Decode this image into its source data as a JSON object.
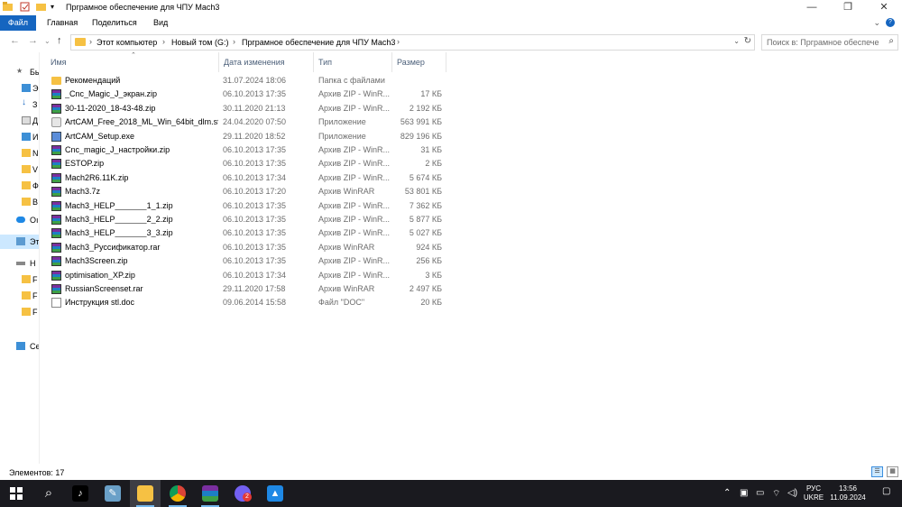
{
  "window": {
    "title": "Прграмное обеспечение для ЧПУ Mach3",
    "minimize": "—",
    "maximize": "❐",
    "close": "✕"
  },
  "ribbon": {
    "tabs": [
      "Файл",
      "Главная",
      "Поделиться",
      "Вид"
    ],
    "expand": "⌄",
    "help": "?"
  },
  "address": {
    "crumbs": [
      "Этот компьютер",
      "Новый том (G:)",
      "Прграмное обеспечение для ЧПУ Mach3"
    ],
    "search_placeholder": "Поиск в: Прграмное обеспече..."
  },
  "columns": {
    "name": "Имя",
    "date": "Дата изменения",
    "type": "Тип",
    "size": "Размер"
  },
  "nav_labels": [
    "Бь",
    "Э",
    "З",
    "Д",
    "И",
    "N",
    "V",
    "Ф",
    "В",
    "Oı",
    "Эт",
    "Н",
    "F",
    "F",
    "F",
    "Се"
  ],
  "files": [
    {
      "name": "Рекомендаций",
      "date": "31.07.2024 18:06",
      "type": "Папка с файлами",
      "size": "",
      "icon": "folder"
    },
    {
      "name": "_Cnc_Magic_J_экран.zip",
      "date": "06.10.2013 17:35",
      "type": "Архив ZIP - WinR...",
      "size": "17 КБ",
      "icon": "zip"
    },
    {
      "name": "30-11-2020_18-43-48.zip",
      "date": "30.11.2020 21:13",
      "type": "Архив ZIP - WinR...",
      "size": "2 192 КБ",
      "icon": "zip"
    },
    {
      "name": "ArtCAM_Free_2018_ML_Win_64bit_dlm.sf...",
      "date": "24.04.2020 07:50",
      "type": "Приложение",
      "size": "563 991 КБ",
      "icon": "app"
    },
    {
      "name": "ArtCAM_Setup.exe",
      "date": "29.11.2020 18:52",
      "type": "Приложение",
      "size": "829 196 КБ",
      "icon": "exe"
    },
    {
      "name": "Cnc_magic_J_настройки.zip",
      "date": "06.10.2013 17:35",
      "type": "Архив ZIP - WinR...",
      "size": "31 КБ",
      "icon": "zip"
    },
    {
      "name": "ESTOP.zip",
      "date": "06.10.2013 17:35",
      "type": "Архив ZIP - WinR...",
      "size": "2 КБ",
      "icon": "zip"
    },
    {
      "name": "Mach2R6.11K.zip",
      "date": "06.10.2013 17:34",
      "type": "Архив ZIP - WinR...",
      "size": "5 674 КБ",
      "icon": "zip"
    },
    {
      "name": "Mach3.7z",
      "date": "06.10.2013 17:20",
      "type": "Архив WinRAR",
      "size": "53 801 КБ",
      "icon": "zip"
    },
    {
      "name": "Mach3_HELP_______1_1.zip",
      "date": "06.10.2013 17:35",
      "type": "Архив ZIP - WinR...",
      "size": "7 362 КБ",
      "icon": "zip"
    },
    {
      "name": "Mach3_HELP_______2_2.zip",
      "date": "06.10.2013 17:35",
      "type": "Архив ZIP - WinR...",
      "size": "5 877 КБ",
      "icon": "zip"
    },
    {
      "name": "Mach3_HELP_______3_3.zip",
      "date": "06.10.2013 17:35",
      "type": "Архив ZIP - WinR...",
      "size": "5 027 КБ",
      "icon": "zip"
    },
    {
      "name": "Mach3_Руссификатор.rar",
      "date": "06.10.2013 17:35",
      "type": "Архив WinRAR",
      "size": "924 КБ",
      "icon": "zip"
    },
    {
      "name": "Mach3Screen.zip",
      "date": "06.10.2013 17:35",
      "type": "Архив ZIP - WinR...",
      "size": "256 КБ",
      "icon": "zip"
    },
    {
      "name": "optimisation_XP.zip",
      "date": "06.10.2013 17:34",
      "type": "Архив ZIP - WinR...",
      "size": "3 КБ",
      "icon": "zip"
    },
    {
      "name": "RussianScreenset.rar",
      "date": "29.11.2020 17:58",
      "type": "Архив WinRAR",
      "size": "2 497 КБ",
      "icon": "zip"
    },
    {
      "name": "Инструкция stl.doc",
      "date": "09.06.2014 15:58",
      "type": "Файл \"DOC\"",
      "size": "20 КБ",
      "icon": "doc"
    }
  ],
  "status": {
    "count": "Элементов: 17"
  },
  "taskbar": {
    "lang_line1": "РУС",
    "lang_line2": "UKRE",
    "time": "13:56",
    "date": "11.09.2024",
    "viber_badge": "2"
  },
  "colors": {
    "accent": "#1565c0",
    "selection": "#cce8ff",
    "folder": "#f6c143",
    "taskbar": "#1a1a1f"
  }
}
